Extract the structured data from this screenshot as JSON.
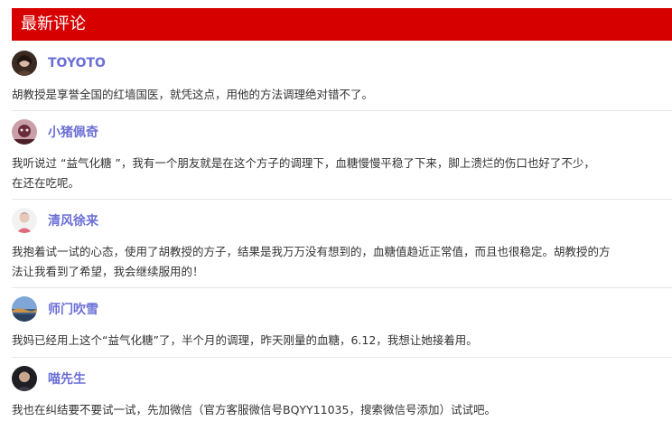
{
  "section": {
    "title": "最新评论"
  },
  "comments": [
    {
      "username": "TOYOTO",
      "lines": [
        "胡教授是享誉全国的红墙国医，就凭这点，用他的方法调理绝对错不了。"
      ]
    },
    {
      "username": "小猪佩奇",
      "lines": [
        "我听说过 “益气化糖 ”，我有一个朋友就是在这个方子的调理下，血糖慢慢平稳了下来，脚上溃烂的伤口也好了不少，",
        "在还在吃呢。"
      ]
    },
    {
      "username": "清风徐来",
      "lines": [
        "我抱着试一试的心态，使用了胡教授的方子，结果是我万万没有想到的，血糖值趋近正常值，而且也很稳定。胡教授的方",
        "法让我看到了希望，我会继续服用的！"
      ]
    },
    {
      "username": "师门吹雪",
      "lines": [
        "我妈已经用上这个“益气化糖”了，半个月的调理，昨天刚量的血糖，6.12，我想让她接着用。"
      ]
    },
    {
      "username": "喵先生",
      "lines": [
        "我也在纠结要不要试一试，先加微信（官方客服微信号BQYY11035，搜索微信号添加）试试吧。"
      ]
    }
  ],
  "colors": {
    "header_bg": "#d70000",
    "username": "#6b6fd6",
    "text": "#333333",
    "divider": "#e6e6e6"
  }
}
